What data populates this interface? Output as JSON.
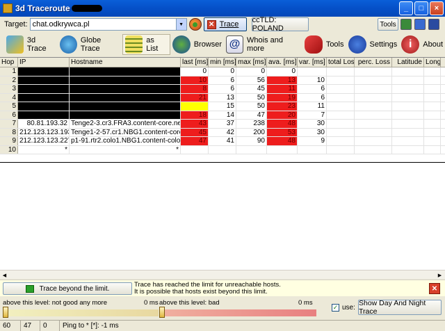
{
  "window": {
    "title": "3d Traceroute",
    "buttons": [
      "_",
      "□",
      "×"
    ]
  },
  "toolbar": {
    "target_label": "Target:",
    "target_value": "chat.odkrywca.pl",
    "trace_label": "Trace",
    "cctld_label": "ccTLD: POLAND",
    "tools_label": "Tools"
  },
  "menu": [
    {
      "label": "3d Trace",
      "icon": "3d-trace-icon"
    },
    {
      "label": "Globe Trace",
      "icon": "globe-icon"
    },
    {
      "label": "as List",
      "icon": "list-icon"
    },
    {
      "label": "Browser",
      "icon": "browser-icon"
    },
    {
      "label": "Whois and more",
      "icon": "whois-icon"
    },
    {
      "label": "Tools",
      "icon": "tools-icon"
    },
    {
      "label": "Settings",
      "icon": "settings-icon"
    },
    {
      "label": "About",
      "icon": "about-icon"
    }
  ],
  "table": {
    "columns": [
      "Hop",
      "IP",
      "Hostname",
      "last [ms]",
      "min [ms]",
      "max [ms]",
      "ava. [ms]",
      "var. [ms]",
      "total Loss",
      "perc. Loss",
      "Latitude",
      "Longi"
    ],
    "rows": [
      {
        "hop": "1",
        "ip": "",
        "host": "",
        "last": "0",
        "min": "0",
        "max": "0",
        "ava": "0",
        "var": "",
        "redacted": true,
        "last_color": "none",
        "ava_color": "none"
      },
      {
        "hop": "2",
        "ip": "",
        "host": "",
        "last": "10",
        "min": "6",
        "max": "56",
        "ava": "13",
        "var": "10",
        "redacted": true,
        "last_color": "red",
        "ava_color": "red"
      },
      {
        "hop": "3",
        "ip": "",
        "host": "",
        "last": "8",
        "min": "6",
        "max": "45",
        "ava": "11",
        "var": "6",
        "redacted": true,
        "last_color": "red",
        "ava_color": "red"
      },
      {
        "hop": "4",
        "ip": "",
        "host": "",
        "last": "21",
        "min": "13",
        "max": "50",
        "ava": "19",
        "var": "6",
        "redacted": true,
        "last_color": "red",
        "ava_color": "red"
      },
      {
        "hop": "5",
        "ip": "",
        "host": "",
        "last": "",
        "min": "15",
        "max": "50",
        "ava": "23",
        "var": "11",
        "redacted": true,
        "last_color": "yellow",
        "ava_color": "red"
      },
      {
        "hop": "6",
        "ip": "",
        "host": "",
        "last": "18",
        "min": "14",
        "max": "47",
        "ava": "20",
        "var": "7",
        "redacted": true,
        "last_color": "red",
        "ava_color": "red"
      },
      {
        "hop": "7",
        "ip": "80.81.193.32",
        "host": "Tenge2-3.cr3.FRA3.content-core.net",
        "last": "43",
        "min": "37",
        "max": "238",
        "ava": "48",
        "var": "30",
        "redacted": false,
        "last_color": "red",
        "ava_color": "red"
      },
      {
        "hop": "8",
        "ip": "212.123.123.193",
        "host": "Tenge1-2-57.cr1.NBG1.content-core.net",
        "last": "45",
        "min": "42",
        "max": "200",
        "ava": "53",
        "var": "30",
        "redacted": false,
        "last_color": "red",
        "ava_color": "red"
      },
      {
        "hop": "9",
        "ip": "212.123.123.227",
        "host": "p1-91.rtr2.colo1.NBG1.content-colo.net",
        "last": "47",
        "min": "41",
        "max": "90",
        "ava": "48",
        "var": "9",
        "redacted": false,
        "last_color": "red",
        "ava_color": "red"
      },
      {
        "hop": "10",
        "ip": "*",
        "host": "*",
        "last": "",
        "min": "",
        "max": "",
        "ava": "",
        "var": "",
        "redacted": false,
        "last_color": "none",
        "ava_color": "none"
      }
    ]
  },
  "notification": {
    "button_label": "Trace beyond the limit.",
    "line1": "Trace has reached the limit for unreachable hosts.",
    "line2": "It is possible that hosts exist beyond this limit."
  },
  "levels": {
    "left_label": "above this level: not good any more",
    "left_value": "0 ms",
    "right_label": "above this level: bad",
    "right_value": "0 ms",
    "use_label": "use:",
    "use_checked": true,
    "daynight_label": "Show Day And Night Trace"
  },
  "status": {
    "a": "60",
    "b": "47",
    "c": "0",
    "ping": "Ping to * [*]: -1 ms"
  },
  "colors": {
    "red": "#ee1d1d",
    "yellow": "#ffff00",
    "titlebar": "#0550c8"
  }
}
